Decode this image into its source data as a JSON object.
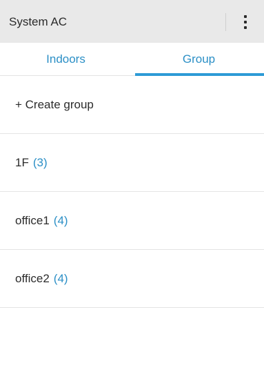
{
  "app": {
    "title": "System AC"
  },
  "tabs": [
    {
      "label": "Indoors",
      "selected": false
    },
    {
      "label": "Group",
      "selected": true
    }
  ],
  "colors": {
    "accent": "#2d9bd6",
    "tab_text": "#2b8fc6",
    "titlebar_bg": "#e9e9e9"
  },
  "icons": {
    "overflow_menu": "more-vert-icon"
  },
  "list": {
    "create_label": "+ Create group",
    "groups": [
      {
        "name": "1F",
        "count": "(3)"
      },
      {
        "name": "office1",
        "count": "(4)"
      },
      {
        "name": "office2",
        "count": "(4)"
      }
    ]
  }
}
